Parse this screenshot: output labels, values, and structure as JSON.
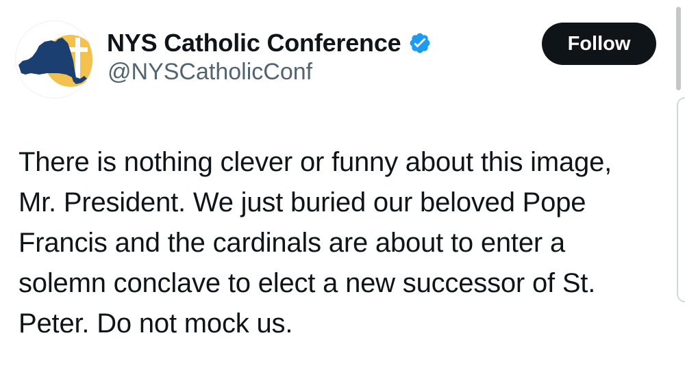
{
  "account": {
    "display_name": "NYS Catholic Conference",
    "handle": "@NYSCatholicConf",
    "avatar_icon": "nys-state-map-cross-logo-icon",
    "verified_icon": "verified-badge-icon"
  },
  "actions": {
    "follow_label": "Follow"
  },
  "tweet": {
    "text": "There is nothing clever or funny about this image,\nMr. President. We just buried our beloved Pope\nFrancis and the cardinals are about to enter a\nsolemn conclave to elect a new successor of St.\nPeter. Do not mock us."
  },
  "colors": {
    "follow_button_bg": "#0f1419",
    "verified_blue": "#1d9bf0",
    "logo_gold": "#f2c14e",
    "logo_navy": "#1c3f72",
    "handle_gray": "#536471"
  }
}
